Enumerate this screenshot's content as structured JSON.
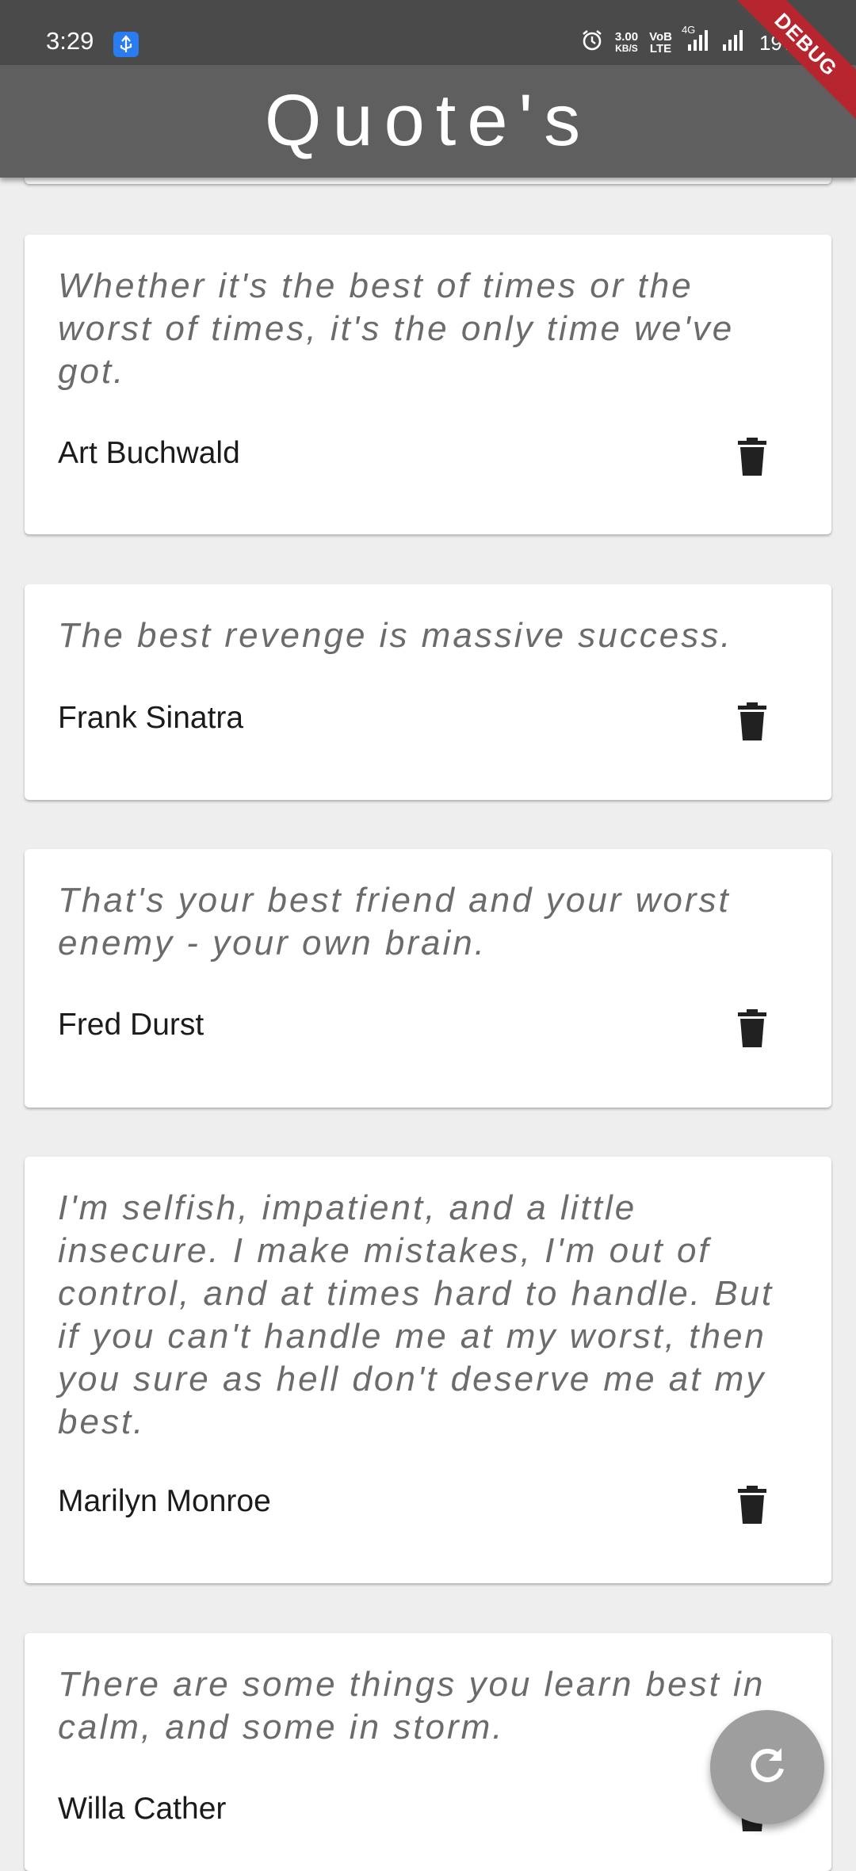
{
  "status": {
    "time": "3:29",
    "net_speed_value": "3.00",
    "net_speed_unit": "KB/S",
    "volte_top": "VoB",
    "volte_bottom": "LTE",
    "network_4g": "4G",
    "battery": "19%"
  },
  "debug_banner": "DEBUG",
  "appbar": {
    "title": "Quote's"
  },
  "quotes": [
    {
      "text": "Whether it's the best of times or the worst of times, it's the only time we've got.",
      "author": "Art Buchwald"
    },
    {
      "text": "The best revenge is massive success.",
      "author": "Frank Sinatra"
    },
    {
      "text": "That's your best friend and your worst enemy - your own brain.",
      "author": "Fred Durst"
    },
    {
      "text": "I'm selfish, impatient, and a little insecure. I make mistakes, I'm out of control, and at times hard to handle. But if you can't handle me at my worst, then you sure as hell don't deserve me at my best.",
      "author": "Marilyn Monroe"
    },
    {
      "text": "There are some things you learn best in calm, and some in storm.",
      "author": "Willa Cather"
    }
  ],
  "icons": {
    "delete": "trash-icon",
    "refresh": "refresh-icon",
    "usb": "usb-icon",
    "alarm": "alarm-icon",
    "signal": "signal-icon"
  },
  "colors": {
    "appbar": "#5f5f5f",
    "statusbar": "#4a4a4a",
    "background": "#eeeeee",
    "card": "#ffffff",
    "fab": "#9e9e9e",
    "debug": "#b7252f"
  }
}
